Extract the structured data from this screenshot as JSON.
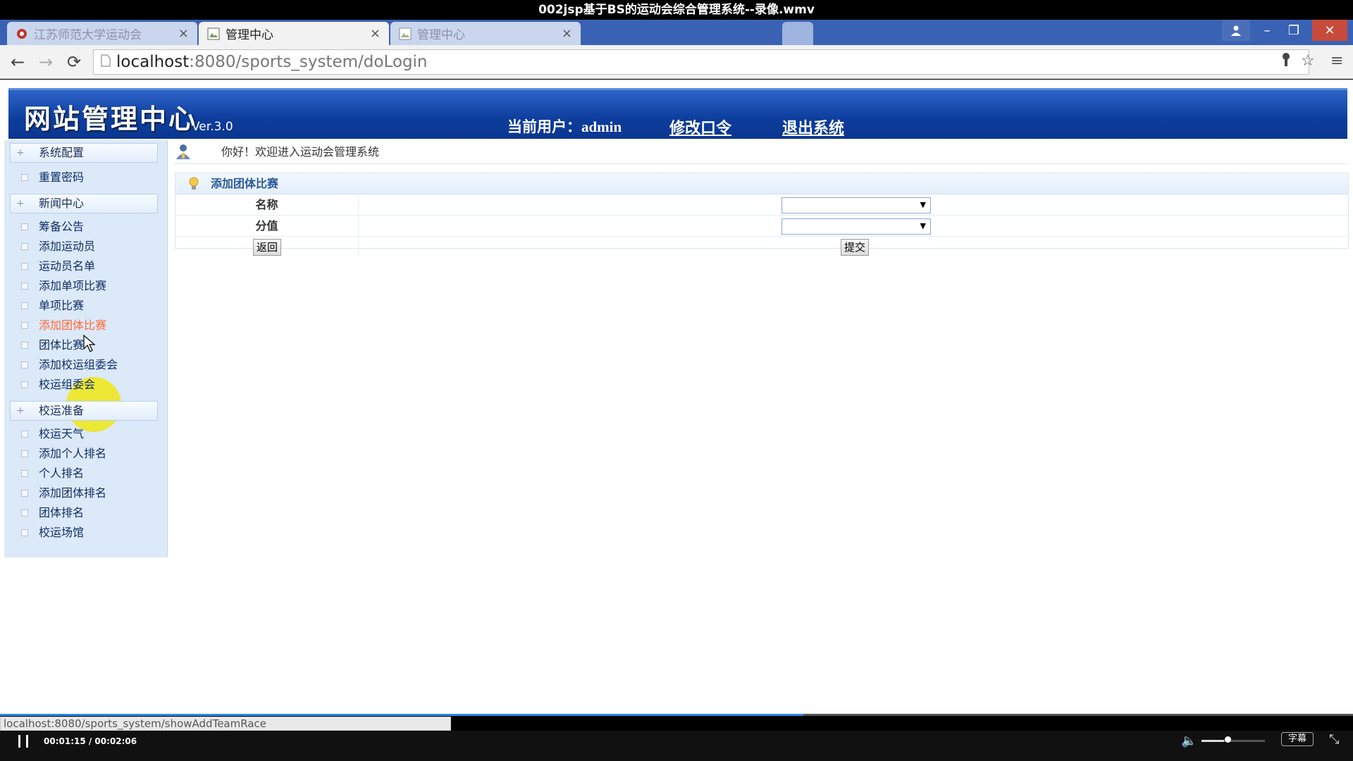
{
  "video": {
    "title": "002jsp基于BS的运动会综合管理系统--录像.wmv",
    "time": "00:01:15 / 00:02:06",
    "progress": 0.594,
    "volume": 0.36,
    "subtitle_label": "字幕"
  },
  "browser": {
    "tabs": [
      {
        "label": "江苏师范大学运动会",
        "active": false
      },
      {
        "label": "管理中心",
        "active": true
      },
      {
        "label": "管理中心",
        "active": false
      }
    ],
    "url_host": "localhost",
    "url_rest": ":8080/sports_system/doLogin",
    "status_url": "localhost:8080/sports_system/showAddTeamRace"
  },
  "header": {
    "logo": "网站管理中心",
    "version": "Ver.3.0",
    "current_user_label": "当前用户：",
    "current_user": "admin",
    "change_password": "修改口令",
    "logout": "退出系统"
  },
  "sidebar": {
    "groups": [
      {
        "label": "系统配置",
        "items": [
          "重置密码"
        ]
      },
      {
        "label": "新闻中心",
        "items": [
          "筹备公告",
          "添加运动员",
          "运动员名单",
          "添加单项比赛",
          "单项比赛",
          "添加团体比赛",
          "团体比赛",
          "添加校运组委会",
          "校运组委会"
        ]
      },
      {
        "label": "校运准备",
        "items": [
          "校运天气",
          "添加个人排名",
          "个人排名",
          "添加团体排名",
          "团体排名",
          "校运场馆"
        ]
      }
    ],
    "hover_item": "添加团体比赛"
  },
  "main": {
    "welcome": "你好！欢迎进入运动会管理系统",
    "form_title": "添加团体比赛",
    "fields": [
      {
        "label": "名称",
        "value": ""
      },
      {
        "label": "分值",
        "value": ""
      }
    ],
    "back_label": "返回",
    "submit_label": "提交"
  },
  "colors": {
    "banner": "#0c3d9c",
    "sidebar_bg": "#dce9f8",
    "hover_text": "#ff6a3a",
    "progress": "#2d8cf0"
  }
}
